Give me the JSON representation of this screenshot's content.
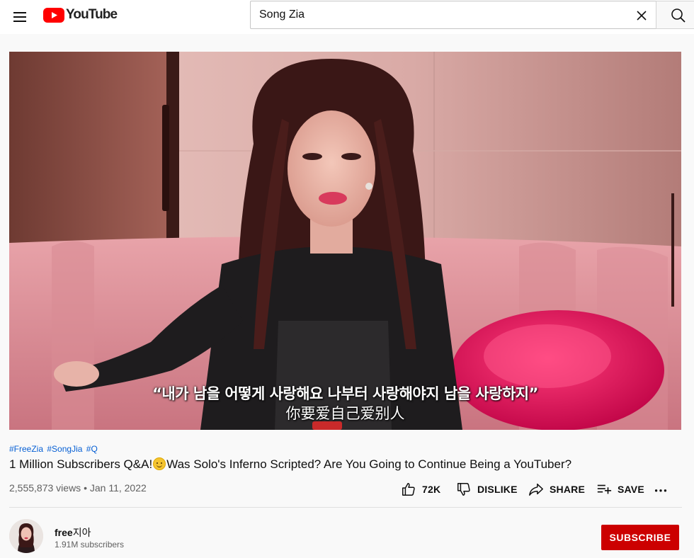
{
  "masthead": {
    "logo_text": "YouTube",
    "search": {
      "value": "Song Zia"
    }
  },
  "player": {
    "caption_korean": "“내가 남을 어떻게 사랑해요 나부터 사랑해야지 남을 사랑하지”",
    "caption_chinese": "你要爱自己爱别人"
  },
  "video": {
    "hashtags": [
      "#FreeZia",
      "#SongJia",
      "#Q"
    ],
    "title_part1": "1 Million Subscribers Q&A!",
    "title_part2": "Was Solo's Inferno Scripted? Are You Going to Continue Being a YouTuber?",
    "views": "2,555,873 views",
    "date": "Jan 11, 2022",
    "meta_separator": "•"
  },
  "actions": {
    "like_count": "72K",
    "dislike_label": "DISLIKE",
    "share_label": "SHARE",
    "save_label": "SAVE"
  },
  "channel": {
    "name_prefix": "free",
    "name_korean": "지아",
    "subscribers": "1.91M subscribers",
    "subscribe_label": "SUBSCRIBE"
  },
  "colors": {
    "brand_red": "#ff0000",
    "subscribe_red": "#cc0000",
    "link_blue": "#065fd4",
    "secondary_text": "#606060"
  },
  "icons": [
    "menu-icon",
    "youtube-logo-icon",
    "clear-icon",
    "search-icon",
    "thumbs-up-icon",
    "thumbs-down-icon",
    "share-icon",
    "save-playlist-icon",
    "more-icon"
  ]
}
